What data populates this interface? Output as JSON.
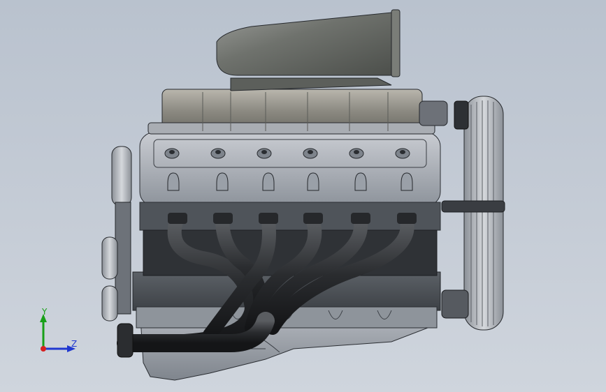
{
  "viewport": {
    "background_top": "#b9c2ce",
    "background_bottom": "#cfd5dd",
    "model": "v12-engine-supercharged",
    "cylinder_ports_per_bank": 6
  },
  "triad": {
    "y_label": "Y",
    "z_label": "Z",
    "x_color": "#d62020",
    "y_color": "#18a018",
    "z_color": "#2038d0"
  }
}
